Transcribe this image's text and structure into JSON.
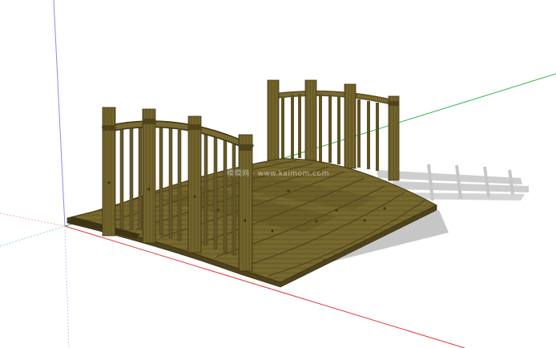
{
  "watermark": "模模网 · www.kaimom.com",
  "colors": {
    "background": "#ffffff",
    "axis_red": "#e23a3a",
    "axis_green": "#2fb44a",
    "axis_blue": "#7a7ae8",
    "wood_light": "#7f6e33",
    "wood_mid": "#6a5b27",
    "wood_dark": "#4f431c",
    "shadow": "#c4c4c4"
  }
}
